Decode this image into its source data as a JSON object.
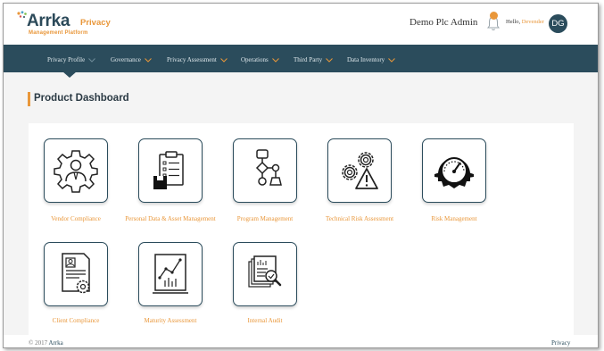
{
  "header": {
    "logo": {
      "brand": "Arrka",
      "brand_suffix": "Privacy",
      "subtitle": "Management Platform"
    },
    "org_name": "Demo Plc Admin",
    "notifications_icon": "bell-icon",
    "greeting_prefix": "Hello,",
    "greeting_name": "Devender",
    "avatar_initials": "DG"
  },
  "nav": {
    "items": [
      {
        "label": "Privacy Profile"
      },
      {
        "label": "Governance"
      },
      {
        "label": "Privacy Assessment"
      },
      {
        "label": "Operations"
      },
      {
        "label": "Third Party"
      },
      {
        "label": "Data Inventory"
      }
    ]
  },
  "main": {
    "page_title": "Product Dashboard",
    "tiles": [
      {
        "label": "Vendor Compliance",
        "icon": "vendor-gear-person-icon"
      },
      {
        "label": "Personal Data & Asset Management",
        "icon": "clipboard-checklist-icon"
      },
      {
        "label": "Program Management",
        "icon": "flowchart-icon"
      },
      {
        "label": "Technical Risk Assessment",
        "icon": "gears-warning-icon"
      },
      {
        "label": "Risk Management",
        "icon": "gauge-gear-icon"
      },
      {
        "label": "Client Compliance",
        "icon": "document-gear-icon"
      },
      {
        "label": "Maturity Assessment",
        "icon": "growth-chart-icon"
      },
      {
        "label": "Internal Audit",
        "icon": "report-magnifier-icon"
      }
    ]
  },
  "footer": {
    "copyright_prefix": "© 2017",
    "copyright_brand": "Arrka",
    "privacy_link": "Privacy"
  },
  "colors": {
    "primary": "#2b4c5c",
    "accent": "#e9973a",
    "background": "#f4f4f4"
  }
}
